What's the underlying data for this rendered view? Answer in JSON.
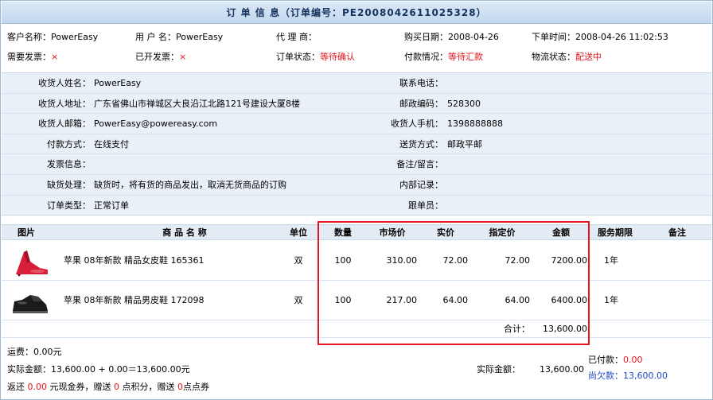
{
  "title": "订 单 信 息（订单编号：PE2008042611025328）",
  "order": {
    "customer_label": "客户名称：",
    "customer": "PowerEasy",
    "user_label": "用 户 名：",
    "user": "PowerEasy",
    "agent_label": "代 理 商：",
    "agent": "",
    "buy_date_label": "购买日期：",
    "buy_date": "2008-04-26",
    "order_time_label": "下单时间：",
    "order_time": "2008-04-26 11:02:53",
    "need_invoice_label": "需要发票：",
    "need_invoice": "×",
    "issued_invoice_label": "已开发票：",
    "issued_invoice": "×",
    "order_status_label": "订单状态：",
    "order_status": "等待确认",
    "payment_label": "付款情况：",
    "payment": "等待汇款",
    "logistics_label": "物流状态：",
    "logistics": "配送中"
  },
  "recipient": {
    "name_label": "收货人姓名：",
    "name": "PowerEasy",
    "phone_label": "联系电话：",
    "phone": "",
    "address_label": "收货人地址：",
    "address": "广东省佛山市禅城区大良沿江北路121号建设大厦8楼",
    "zip_label": "邮政编码：",
    "zip": "528300",
    "email_label": "收货人邮箱：",
    "email": "PowerEasy@powereasy.com",
    "mobile_label": "收货人手机：",
    "mobile": "1398888888",
    "pay_method_label": "付款方式：",
    "pay_method": "在线支付",
    "ship_method_label": "送货方式：",
    "ship_method": "邮政平邮",
    "invoice_info_label": "发票信息：",
    "invoice_info": "",
    "note_label": "备注/留言：",
    "note": "",
    "shortage_label": "缺货处理：",
    "shortage": "缺货时，将有货的商品发出，取消无货商品的订购",
    "internal_label": "内部记录：",
    "internal": "",
    "order_type_label": "订单类型：",
    "order_type": "正常订单",
    "follow_label": "跟单员：",
    "follow": ""
  },
  "table": {
    "headers": {
      "image": "图片",
      "name": "商 品 名 称",
      "unit": "单位",
      "qty": "数量",
      "market": "市场价",
      "actual": "实价",
      "fixed": "指定价",
      "amount": "金额",
      "service": "服务期限",
      "remark": "备注"
    },
    "rows": [
      {
        "image": "red-shoe",
        "name": "苹果 08年新款 精品女皮鞋 165361",
        "unit": "双",
        "qty": "100",
        "market": "310.00",
        "actual": "72.00",
        "fixed": "72.00",
        "amount": "7200.00",
        "service": "1年",
        "remark": ""
      },
      {
        "image": "black-shoe",
        "name": "苹果 08年新款 精品男皮鞋 172098",
        "unit": "双",
        "qty": "100",
        "market": "217.00",
        "actual": "64.00",
        "fixed": "64.00",
        "amount": "6400.00",
        "service": "1年",
        "remark": ""
      }
    ],
    "total_label": "合计：",
    "total": "13,600.00"
  },
  "summary": {
    "shipping": "运费：0.00元",
    "actual_amount": "实际金额：13,600.00 + 0.00＝13,600.00元",
    "return_prefix": "返还 ",
    "return_cash": "0.00",
    "return_mid1": " 元现金券，赠送 ",
    "return_points": "0",
    "return_mid2": " 点积分，赠送 ",
    "return_coupon": "0",
    "return_suffix": "点点券",
    "actual_label": "实际金额：",
    "actual_value": "13,600.00",
    "paid_label": "已付款：",
    "paid_value": "0.00",
    "owed_label": "尚欠款：",
    "owed_value": "13,600.00"
  },
  "colors": {
    "highlight": "#e3141b",
    "accent_blue": "#1f47c9",
    "title_text": "#15335f"
  }
}
